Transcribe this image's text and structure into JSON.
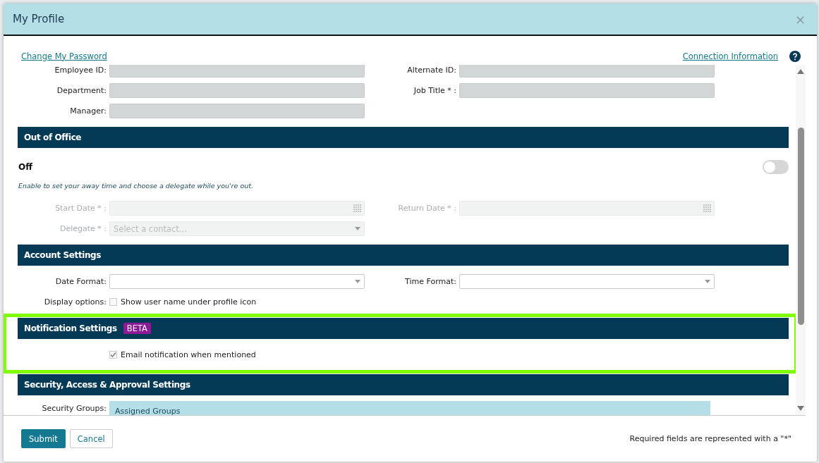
{
  "window": {
    "title": "My Profile",
    "close": "×"
  },
  "links": [
    {
      "label": "Change My Password"
    },
    {
      "label": "Connection Information"
    }
  ],
  "sections": [
    {
      "highlighted": false,
      "items": [
        {
          "kind": "fields",
          "fields": [
            {
              "label": "Employee ID:",
              "kind": "readonly",
              "disabled": false
            },
            {
              "label": "Alternate ID:",
              "kind": "readonly",
              "disabled": false
            }
          ]
        },
        {
          "kind": "fields",
          "fields": [
            {
              "label": "Department:",
              "kind": "readonly",
              "disabled": false
            },
            {
              "label": "Job Title * :",
              "kind": "readonly",
              "disabled": false
            }
          ]
        },
        {
          "kind": "fields",
          "fields": [
            {
              "label": "Manager:",
              "kind": "readonly",
              "disabled": false
            }
          ]
        }
      ]
    },
    {
      "title": "Out of Office",
      "highlighted": false,
      "items": [
        {
          "kind": "toggle",
          "label": "Off",
          "on": false
        },
        {
          "kind": "hint",
          "text": "Enable to set your away time and choose a delegate while you're out."
        },
        {
          "kind": "fields",
          "fields": [
            {
              "label": "Start Date * :",
              "kind": "date",
              "disabled": true
            },
            {
              "label": "Return Date * :",
              "kind": "date",
              "disabled": true
            }
          ]
        },
        {
          "kind": "fields",
          "fields": [
            {
              "label": "Delegate * :",
              "kind": "select",
              "disabled": true,
              "placeholder": "Select a contact..."
            }
          ]
        }
      ]
    },
    {
      "title": "Account Settings",
      "highlighted": false,
      "items": [
        {
          "kind": "fields",
          "fields": [
            {
              "label": "Date Format:",
              "kind": "select",
              "disabled": false
            },
            {
              "label": "Time Format:",
              "kind": "select",
              "disabled": false
            }
          ]
        },
        {
          "kind": "checkbox",
          "label": "Display options:",
          "text": "Show user name under profile icon",
          "checked": false
        }
      ]
    },
    {
      "title": "Notification Settings",
      "badge": "BETA",
      "highlighted": true,
      "items": [
        {
          "kind": "checkbox",
          "text": "Email notification when mentioned",
          "checked": true
        }
      ]
    },
    {
      "title": "Security, Access & Approval Settings",
      "highlighted": false,
      "items": [
        {
          "kind": "list",
          "label": "Security Groups:",
          "value": "Assigned Groups"
        }
      ]
    }
  ],
  "footer": {
    "buttons": [
      {
        "label": "Submit",
        "kind": "primary"
      },
      {
        "label": "Cancel",
        "kind": "secondary"
      }
    ],
    "note": "Required fields are represented with a \"*\""
  }
}
